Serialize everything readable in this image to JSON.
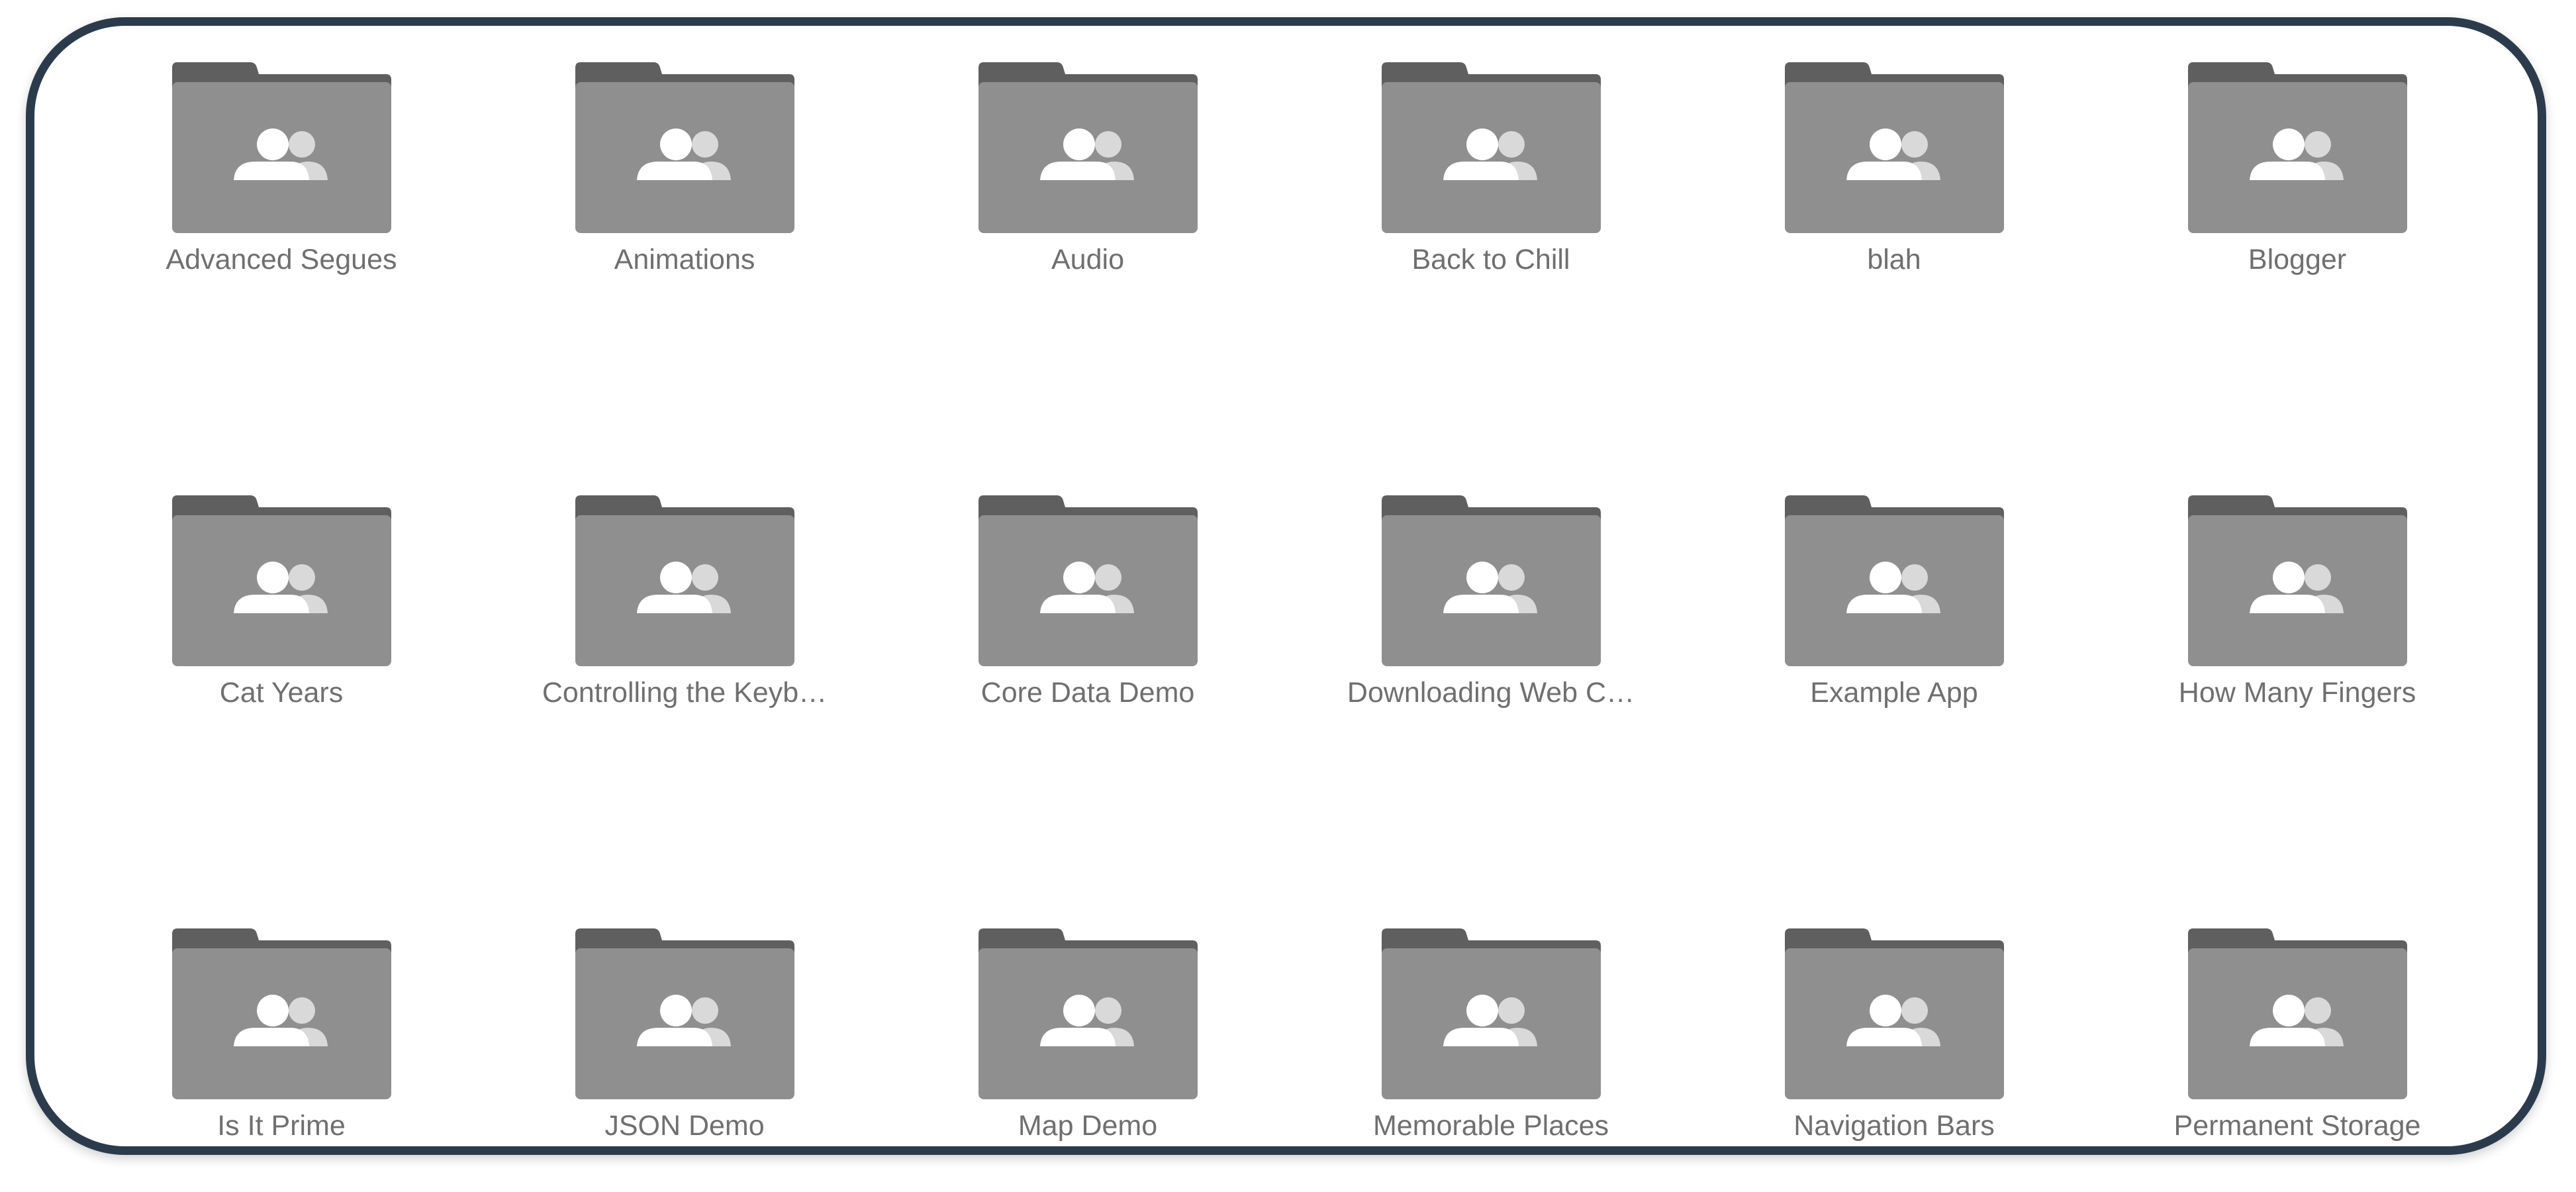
{
  "folders": [
    {
      "label": "Advanced Segues",
      "icon": "shared-folder-icon"
    },
    {
      "label": "Animations",
      "icon": "shared-folder-icon"
    },
    {
      "label": "Audio",
      "icon": "shared-folder-icon"
    },
    {
      "label": "Back to Chill",
      "icon": "shared-folder-icon"
    },
    {
      "label": "blah",
      "icon": "shared-folder-icon"
    },
    {
      "label": "Blogger",
      "icon": "shared-folder-icon"
    },
    {
      "label": "Cat Years",
      "icon": "shared-folder-icon"
    },
    {
      "label": "Controlling the Keyb…",
      "icon": "shared-folder-icon"
    },
    {
      "label": "Core Data Demo",
      "icon": "shared-folder-icon"
    },
    {
      "label": "Downloading Web C…",
      "icon": "shared-folder-icon"
    },
    {
      "label": "Example App",
      "icon": "shared-folder-icon"
    },
    {
      "label": "How Many Fingers",
      "icon": "shared-folder-icon"
    },
    {
      "label": "Is It Prime",
      "icon": "shared-folder-icon"
    },
    {
      "label": "JSON Demo",
      "icon": "shared-folder-icon"
    },
    {
      "label": "Map Demo",
      "icon": "shared-folder-icon"
    },
    {
      "label": "Memorable Places",
      "icon": "shared-folder-icon"
    },
    {
      "label": "Navigation Bars",
      "icon": "shared-folder-icon"
    },
    {
      "label": "Permanent Storage",
      "icon": "shared-folder-icon"
    }
  ],
  "colors": {
    "frame_border": "#2c3b4c",
    "folder_tab": "#5f5f5f",
    "folder_body": "#8f8f8f",
    "person_primary": "#ffffff",
    "person_secondary": "#d9d9d9",
    "label_text": "#6f6f6f"
  }
}
